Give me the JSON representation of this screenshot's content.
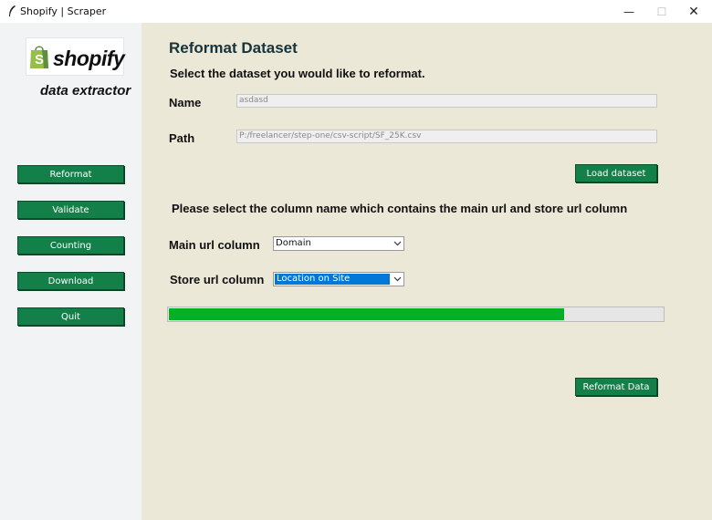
{
  "window": {
    "title": "Shopify | Scraper",
    "controls": {
      "minimize": "—",
      "maximize": "☐",
      "close": "✕"
    }
  },
  "sidebar": {
    "logo": {
      "text": "shopify",
      "bag_letter": "S",
      "bag_color": "#95bf47",
      "bag_dark_color": "#5e8e3e"
    },
    "tagline": "data extractor",
    "buttons": [
      {
        "label": "Reformat"
      },
      {
        "label": "Validate"
      },
      {
        "label": "Counting"
      },
      {
        "label": "Download"
      },
      {
        "label": "Quit"
      }
    ]
  },
  "main": {
    "title": "Reformat Dataset",
    "subtitle": "Select the dataset you would like to reformat.",
    "name": {
      "label": "Name",
      "value": "asdasd"
    },
    "path": {
      "label": "Path",
      "value": "P:/freelancer/step-one/csv-script/SF_25K.csv"
    },
    "load_button": "Load dataset",
    "instruction": "Please select the column name which contains the main url and store url column",
    "main_url": {
      "label": "Main url column",
      "value": "Domain"
    },
    "store_url": {
      "label": "Store url column",
      "value": "Location on Site"
    },
    "progress": {
      "value": 0.8,
      "fill_color": "#06b025"
    },
    "reformat_button": "Reformat Data"
  },
  "colors": {
    "sidebar_bg": "#f2f3f5",
    "main_bg": "#ece8d8",
    "button_green": "#13804a",
    "heading": "#16333a",
    "selection": "#0078d7"
  }
}
